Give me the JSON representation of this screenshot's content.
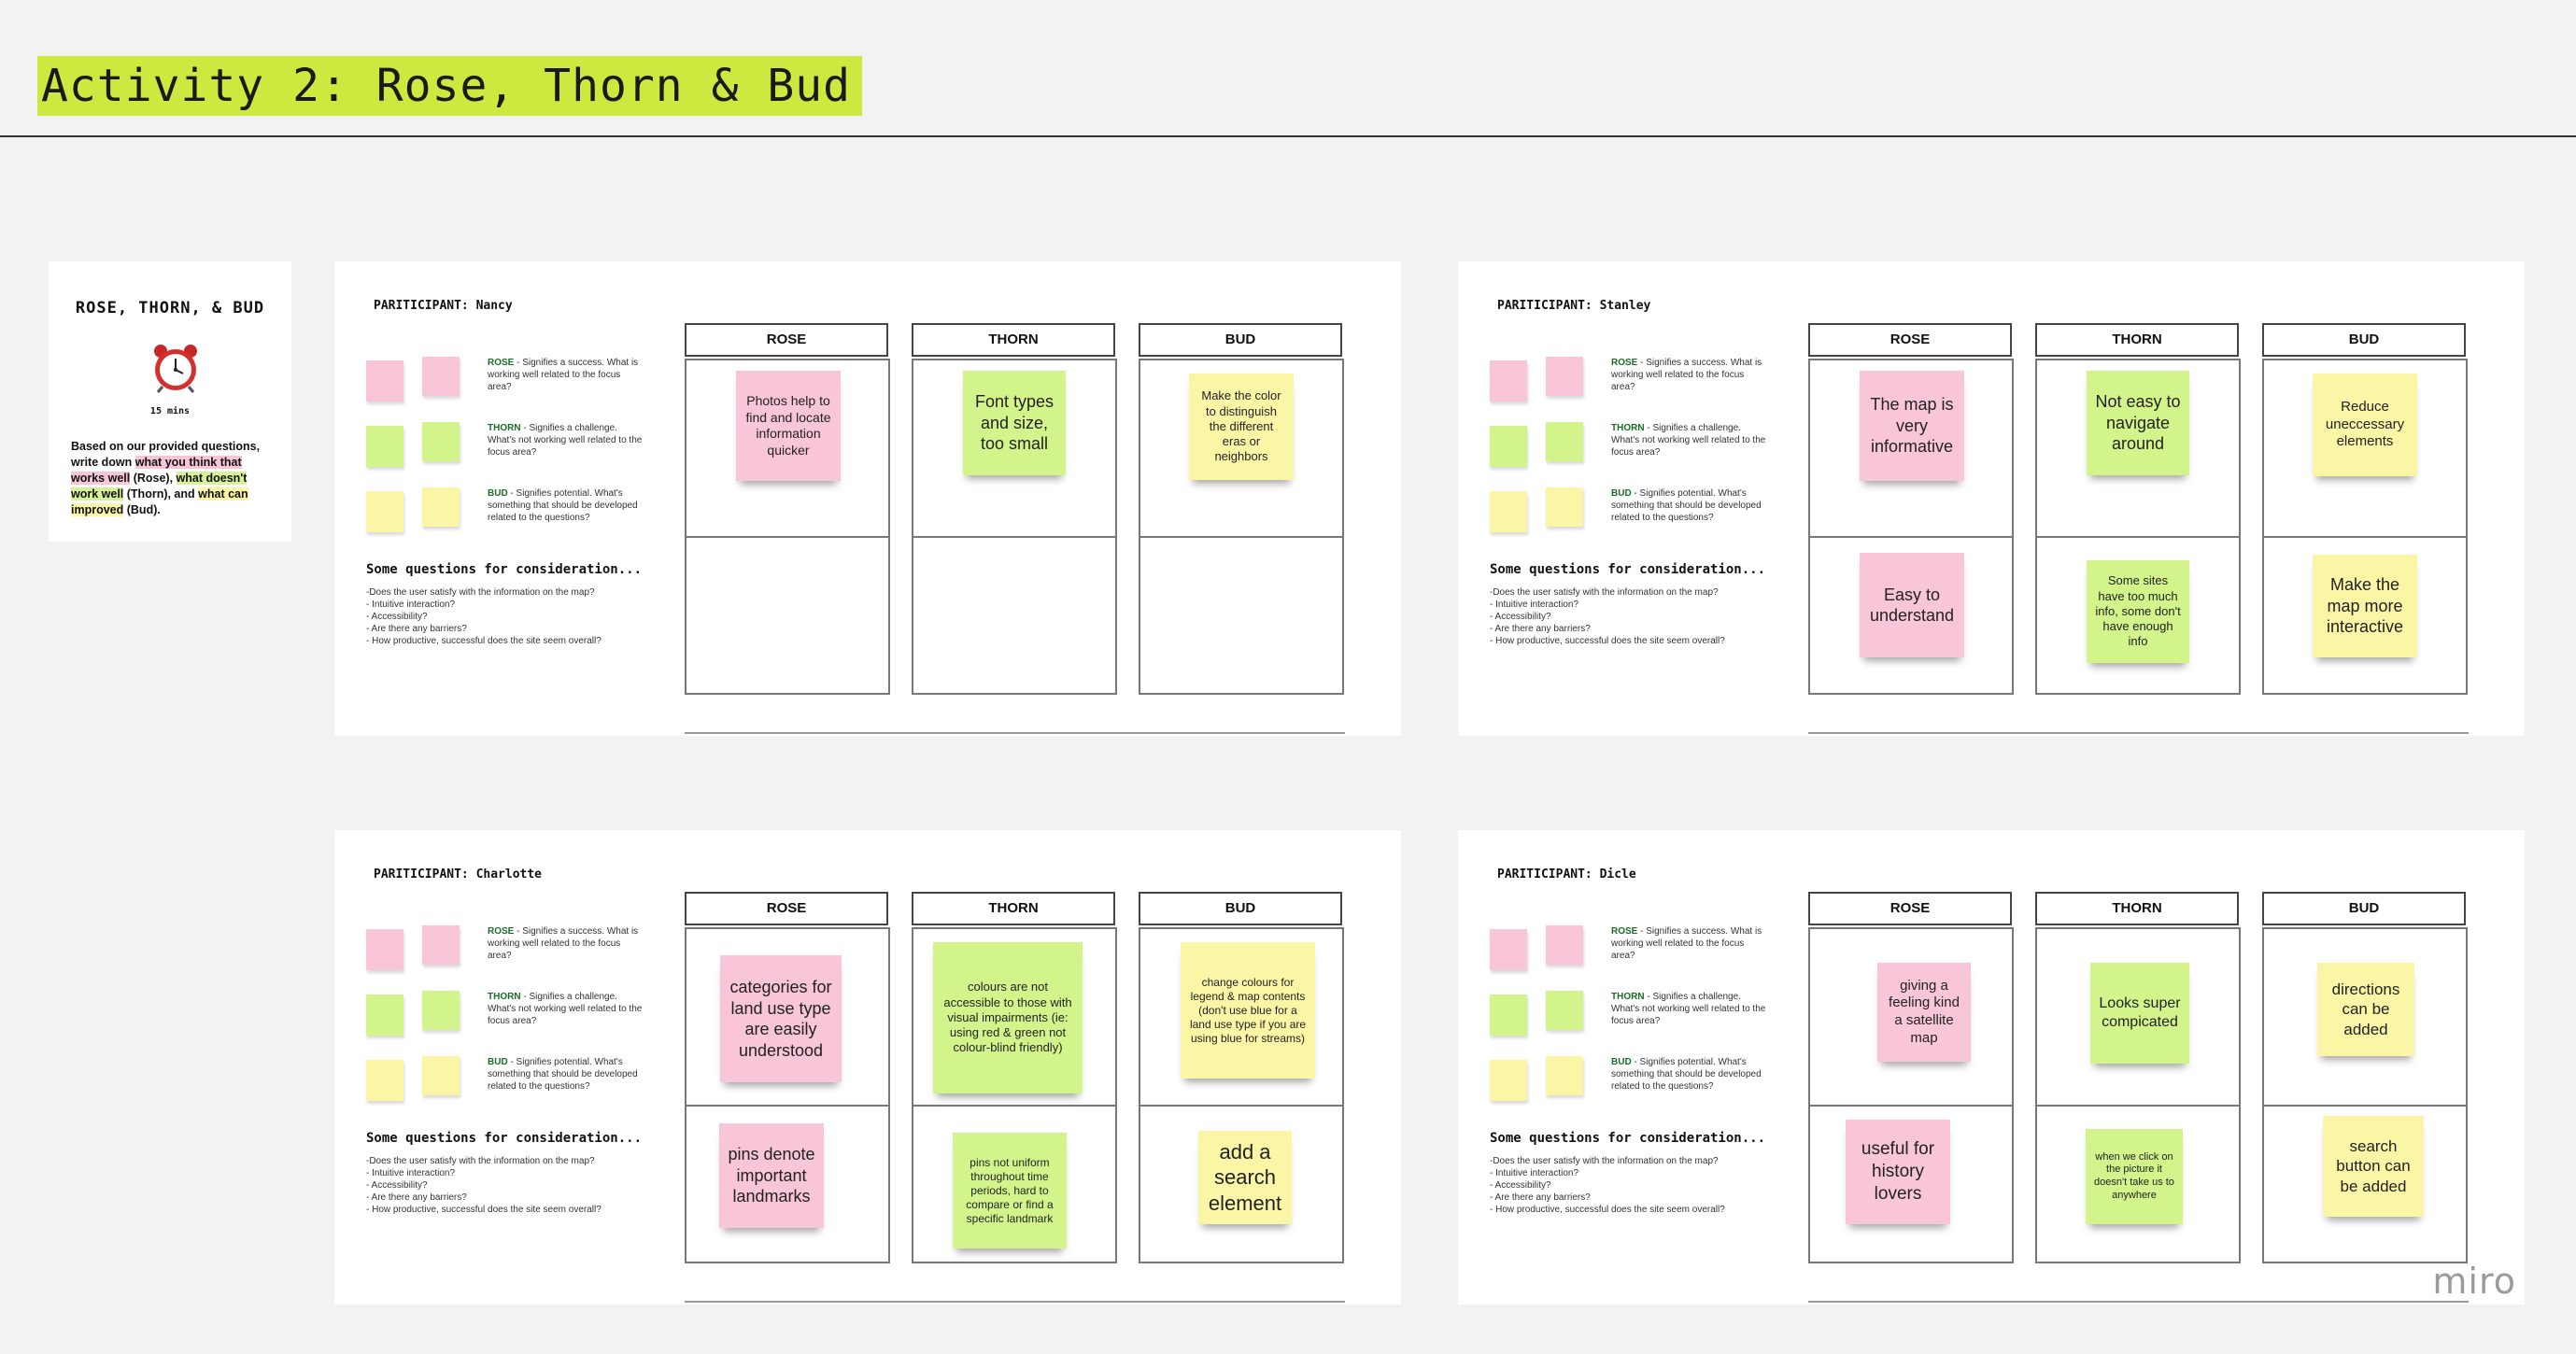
{
  "header": {
    "title": "Activity 2: Rose, Thorn & Bud"
  },
  "instructions": {
    "title": "ROSE, THORN, & BUD",
    "duration": "15 mins",
    "desc": {
      "p1": "Based on our provided questions, write down ",
      "h1": "what you think that works well",
      "p2": " (Rose), ",
      "h2": "what doesn't work well",
      "p3": " (Thorn), and ",
      "h3": "what can improved",
      "p4": " (Bud)."
    }
  },
  "legend": {
    "rose_label": "ROSE",
    "rose_text": " - Signifies a success. What is working well related to the focus area?",
    "thorn_label": "THORN",
    "thorn_text": " - Signifies a challenge. What's not working well related to the focus area?",
    "bud_label": "BUD",
    "bud_text": " - Signifies potential. What's something that should be developed related to the questions?"
  },
  "questions": {
    "title": "Some questions for consideration...",
    "items": [
      "-Does the user satisfy with the information on the map?",
      "- Intuitive interaction?",
      "- Accessibility?",
      "- Are there any barriers?",
      "- How productive, successful does the site seem overall?"
    ]
  },
  "columns": {
    "rose": "ROSE",
    "thorn": "THORN",
    "bud": "BUD"
  },
  "boards": [
    {
      "participant": "PARITICIPANT: Nancy",
      "rose": [
        "Photos help to find and locate information quicker"
      ],
      "thorn": [
        "Font types and size, too small"
      ],
      "bud": [
        "Make the color to distinguish the different eras or neighbors"
      ]
    },
    {
      "participant": "PARITICIPANT: Stanley",
      "rose": [
        "The map is very informative",
        "Easy to understand"
      ],
      "thorn": [
        "Not easy to navigate around",
        "Some sites have too much info, some don't have enough info"
      ],
      "bud": [
        "Reduce uneccessary elements",
        "Make the map more interactive"
      ]
    },
    {
      "participant": "PARITICIPANT: Charlotte",
      "rose": [
        "categories for land use type are easily understood",
        "pins denote important landmarks"
      ],
      "thorn": [
        "colours are not accessible to those with visual impairments (ie: using red & green not colour-blind friendly)",
        "pins not uniform throughout time periods, hard to compare or find a specific landmark"
      ],
      "bud": [
        "change colours for legend & map contents (don't use blue for a land use type if you are using blue for streams)",
        "add a search element"
      ]
    },
    {
      "participant": "PARITICIPANT: Dicle",
      "rose": [
        "giving a feeling kind a satellite map",
        "useful for history lovers"
      ],
      "thorn": [
        "Looks super compicated",
        "when we click on the picture it doesn't take us to anywhere"
      ],
      "bud": [
        "directions can be added",
        "search button can be added"
      ]
    }
  ],
  "brand": "miro",
  "colors": {
    "rose": "#f8c5d9",
    "thorn": "#d3f38b",
    "bud": "#fbf6a6",
    "title_highlight": "#cfe840"
  }
}
